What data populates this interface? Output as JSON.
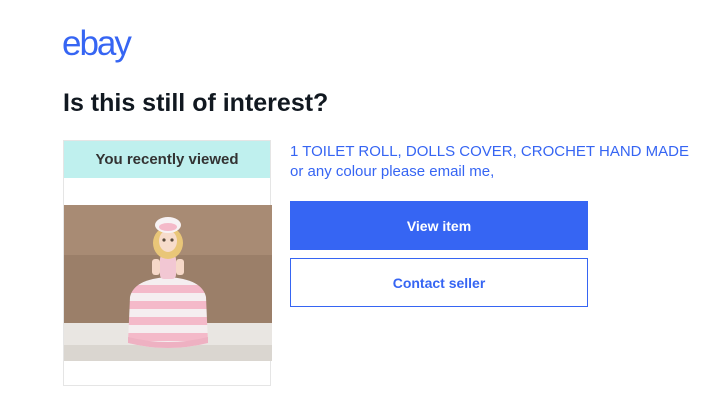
{
  "brand": {
    "logo_text": "ebay"
  },
  "headline": "Is this still of interest?",
  "recent": {
    "label": "You recently viewed",
    "image_icon": "crochet-toilet-roll-doll-photo"
  },
  "item": {
    "title_line1": "1 TOILET ROLL, DOLLS COVER, CROCHET HAND MADE",
    "title_line2": "or any colour please email me,"
  },
  "actions": {
    "view_label": "View item",
    "contact_label": "Contact seller"
  },
  "colors": {
    "accent": "#3665f3",
    "heading": "#111820",
    "label_bg": "#bff0ee"
  }
}
